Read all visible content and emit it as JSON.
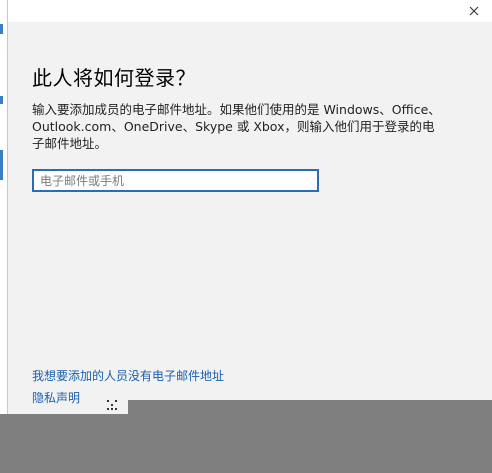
{
  "dialog": {
    "heading": "此人将如何登录？",
    "description": "输入要添加成员的电子邮件地址。如果他们使用的是 Windows、Office、Outlook.com、OneDrive、Skype 或 Xbox，则输入他们用于登录的电子邮件地址。",
    "email_input": {
      "value": "",
      "placeholder": "电子邮件或手机"
    },
    "links": {
      "no_email": "我想要添加的人员没有电子邮件地址",
      "privacy": "隐私声明"
    },
    "close_icon": "close-icon"
  },
  "colors": {
    "accent": "#2b6cb3",
    "link": "#1b5fae",
    "dialog_bg": "#f2f2f2",
    "taskbar": "#7f7f7f"
  }
}
